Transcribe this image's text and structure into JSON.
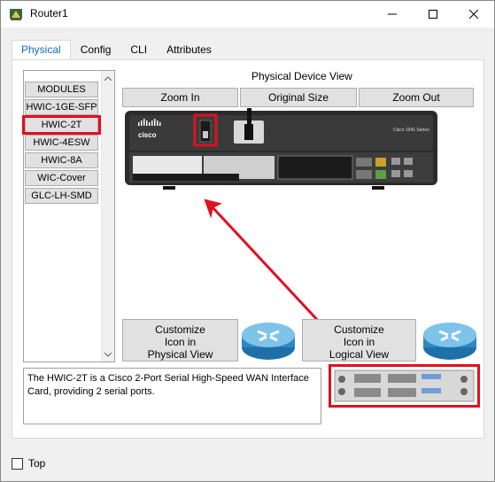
{
  "window": {
    "title": "Router1"
  },
  "tabs": [
    {
      "label": "Physical",
      "active": true
    },
    {
      "label": "Config",
      "active": false
    },
    {
      "label": "CLI",
      "active": false
    },
    {
      "label": "Attributes",
      "active": false
    }
  ],
  "modules": [
    "MODULES",
    "HWIC-1GE-SFP",
    "HWIC-2T",
    "HWIC-4ESW",
    "HWIC-8A",
    "WIC-Cover",
    "GLC-LH-SMD"
  ],
  "selected_module": "HWIC-2T",
  "device_view": {
    "heading": "Physical Device View",
    "zoom_in": "Zoom In",
    "original_size": "Original Size",
    "zoom_out": "Zoom Out",
    "router_model": "Cisco 1941 Series",
    "brand": "cisco"
  },
  "customize": {
    "physical": [
      "Customize",
      "Icon in",
      "Physical View"
    ],
    "logical": [
      "Customize",
      "Icon in",
      "Logical View"
    ]
  },
  "description": "The HWIC-2T is a Cisco 2-Port Serial High-Speed WAN Interface Card, providing 2 serial ports.",
  "footer": {
    "top_label": "Top"
  },
  "colors": {
    "highlight": "#e01020",
    "tab_active_text": "#0b6bc9",
    "router_blue": "#2f87c4"
  },
  "icons": {
    "router": "router-icon",
    "app": "packet-tracer-icon"
  }
}
